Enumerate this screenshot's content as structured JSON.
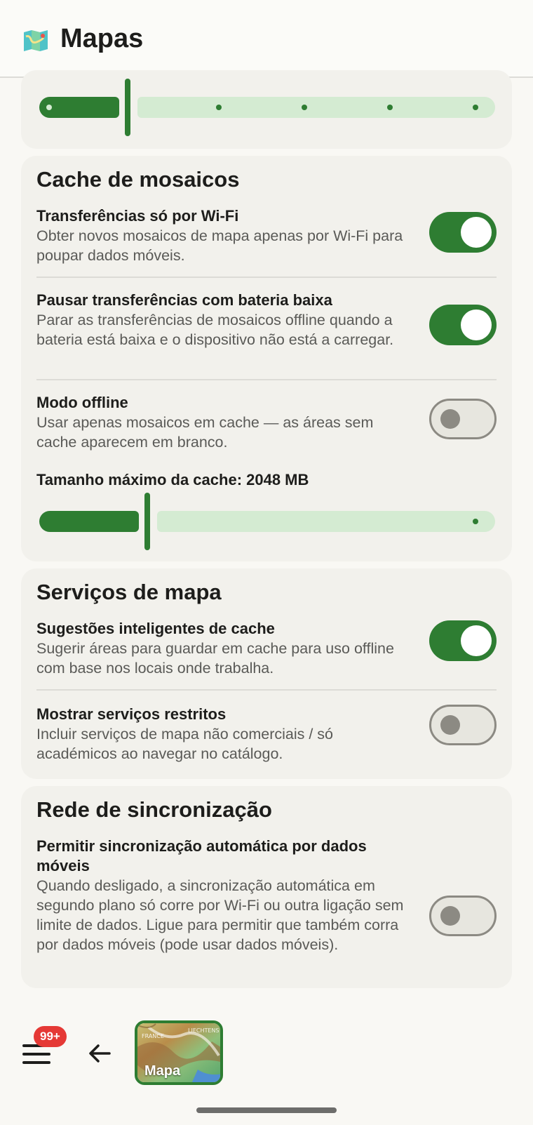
{
  "app_bar": {
    "title": "Mapas",
    "icon": "map-icon"
  },
  "slider_top": {
    "value_fraction": 0.2,
    "ticks": 5
  },
  "tile_cache": {
    "title": "Cache de mosaicos",
    "wifi_only": {
      "title": "Transferências só por Wi-Fi",
      "desc": "Obter novos mosaicos de mapa apenas por Wi-Fi para poupar dados móveis.",
      "enabled": true
    },
    "pause_low_battery": {
      "title": "Pausar transferências com bateria baixa",
      "desc": "Parar as transferências de mosaicos offline quando a bateria está baixa e o dispositivo não está a carregar.",
      "enabled": true
    },
    "offline_mode": {
      "title": "Modo offline",
      "desc": "Usar apenas mosaicos em cache — as áreas sem cache aparecem em branco.",
      "enabled": false
    },
    "max_cache": {
      "label": "Tamanho máximo da cache: 2048 MB",
      "value_fraction": 0.25
    }
  },
  "map_services": {
    "title": "Serviços de mapa",
    "smart_cache": {
      "title": "Sugestões inteligentes de cache",
      "desc": "Sugerir áreas para guardar em cache para uso offline com base nos locais onde trabalha.",
      "enabled": true
    },
    "restricted": {
      "title": "Mostrar serviços restritos",
      "desc": "Incluir serviços de mapa não comerciais / só académicos ao navegar no catálogo.",
      "enabled": false
    }
  },
  "sync_network": {
    "title": "Rede de sincronização",
    "mobile_sync": {
      "title": "Permitir sincronização automática por dados móveis",
      "desc": "Quando desligado, a sincronização automática em segundo plano só corre por Wi-Fi ou outra ligação sem limite de dados. Ligue para permitir que também corra por dados móveis (pode usar dados móveis).",
      "enabled": false
    }
  },
  "bottom_bar": {
    "badge": "99+",
    "map_label": "Mapa",
    "map_tiny_labels": [
      "FRANCE",
      "LIECHTENS"
    ]
  },
  "colors": {
    "accent": "#2e7d32",
    "track_inactive": "#d4ebd2",
    "badge": "#e53935"
  }
}
